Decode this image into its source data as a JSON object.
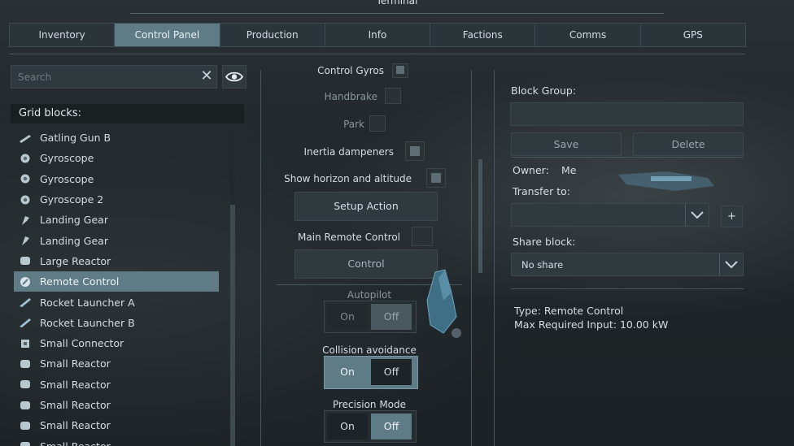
{
  "header": {
    "title": "Terminal"
  },
  "tabs": [
    "Inventory",
    "Control Panel",
    "Production",
    "Info",
    "Factions",
    "Comms",
    "GPS"
  ],
  "left": {
    "search_placeholder": "Search",
    "grid_heading": "Grid blocks:",
    "items": [
      {
        "label": "Gatling Gun B",
        "icon": "gun-icon"
      },
      {
        "label": "Gyroscope",
        "icon": "gyroscope-icon"
      },
      {
        "label": "Gyroscope",
        "icon": "gyroscope-icon"
      },
      {
        "label": "Gyroscope 2",
        "icon": "gyroscope-icon"
      },
      {
        "label": "Landing Gear",
        "icon": "landing-gear-icon"
      },
      {
        "label": "Landing Gear",
        "icon": "landing-gear-icon"
      },
      {
        "label": "Large Reactor",
        "icon": "reactor-icon"
      },
      {
        "label": "Remote Control",
        "icon": "remote-control-icon"
      },
      {
        "label": "Rocket Launcher A",
        "icon": "rocket-icon"
      },
      {
        "label": "Rocket Launcher B",
        "icon": "rocket-icon"
      },
      {
        "label": "Small Connector",
        "icon": "connector-icon"
      },
      {
        "label": "Small Reactor",
        "icon": "reactor-icon"
      },
      {
        "label": "Small Reactor",
        "icon": "reactor-icon"
      },
      {
        "label": "Small Reactor",
        "icon": "reactor-icon"
      },
      {
        "label": "Small Reactor",
        "icon": "reactor-icon"
      },
      {
        "label": "Small Reactor",
        "icon": "reactor-icon"
      }
    ]
  },
  "middle": {
    "control_gyros": "Control Gyros",
    "handbrake": "Handbrake",
    "park": "Park",
    "inertia": "Inertia dampeners",
    "horizon": "Show horizon and altitude",
    "setup_action": "Setup Action",
    "main_remote": "Main Remote Control",
    "control": "Control",
    "autopilot": "Autopilot",
    "collision": "Collision avoidance",
    "precision": "Precision Mode",
    "on": "On",
    "off": "Off"
  },
  "right": {
    "block_group": "Block Group:",
    "save": "Save",
    "delete": "Delete",
    "owner_label": "Owner:",
    "owner_value": "Me",
    "transfer_to": "Transfer to:",
    "plus": "+",
    "share_block": "Share block:",
    "share_value": "No share",
    "type_line": "Type: Remote Control",
    "max_input_line": "Max Required Input: 10.00 kW"
  },
  "colors": {
    "accent": "#5f7b86",
    "panel": "#2f393e",
    "background": "#1f2629"
  }
}
